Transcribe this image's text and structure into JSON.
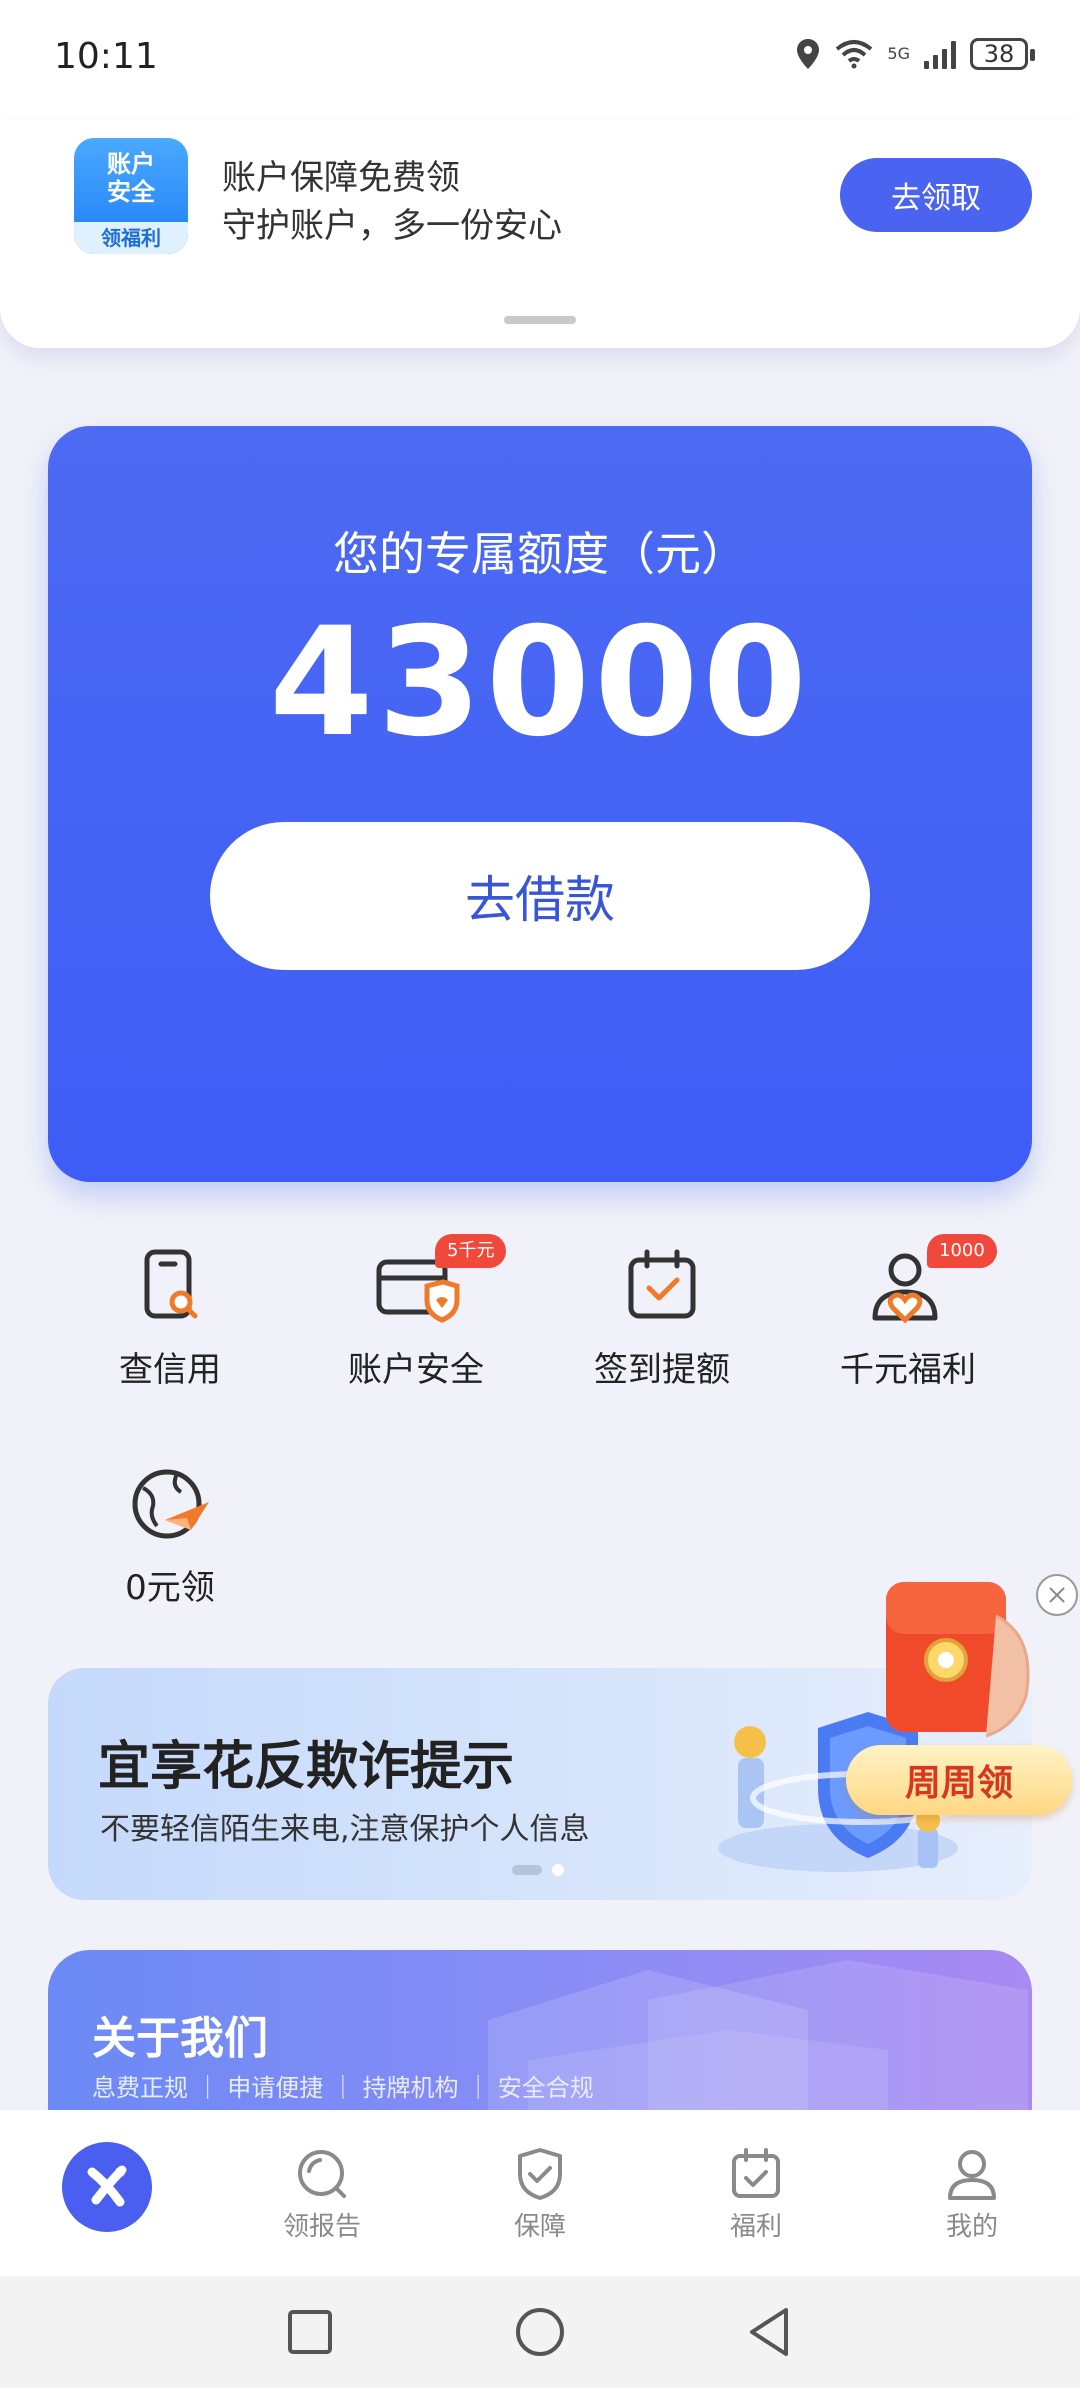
{
  "status_bar": {
    "time": "10:11",
    "network": "5G",
    "battery": "38"
  },
  "banner": {
    "logo_line1": "账户",
    "logo_line2": "安全",
    "logo_line3": "领福利",
    "title": "账户保障免费领",
    "subtitle": "守护账户，多一份安心",
    "button": "去领取"
  },
  "credit": {
    "label": "您的专属额度（元）",
    "amount": "43000",
    "button": "去借款"
  },
  "menu": [
    {
      "label": "查信用",
      "icon": "phone-search-icon"
    },
    {
      "label": "账户安全",
      "icon": "card-shield-icon",
      "badge": "5千元"
    },
    {
      "label": "签到提额",
      "icon": "calendar-check-icon"
    },
    {
      "label": "千元福利",
      "icon": "user-heart-icon",
      "badge": "1000"
    },
    {
      "label": "0元领",
      "icon": "globe-plane-icon"
    }
  ],
  "fraud_banner": {
    "title": "宜享花反欺诈提示",
    "subtitle": "不要轻信陌生来电,注意保护个人信息"
  },
  "float_promo": {
    "button": "周周领"
  },
  "about": {
    "title": "关于我们",
    "tags": "息费正规 ｜ 申请便捷 ｜ 持牌机构 ｜ 安全合规"
  },
  "tabs": [
    {
      "label": "",
      "icon": "home-logo-icon"
    },
    {
      "label": "领报告",
      "icon": "report-search-icon"
    },
    {
      "label": "保障",
      "icon": "shield-check-icon"
    },
    {
      "label": "福利",
      "icon": "calendar-gift-icon"
    },
    {
      "label": "我的",
      "icon": "profile-icon"
    }
  ],
  "colors": {
    "primary": "#4a63f0",
    "badge": "#f0493b",
    "accent_orange": "#f07a2a"
  }
}
